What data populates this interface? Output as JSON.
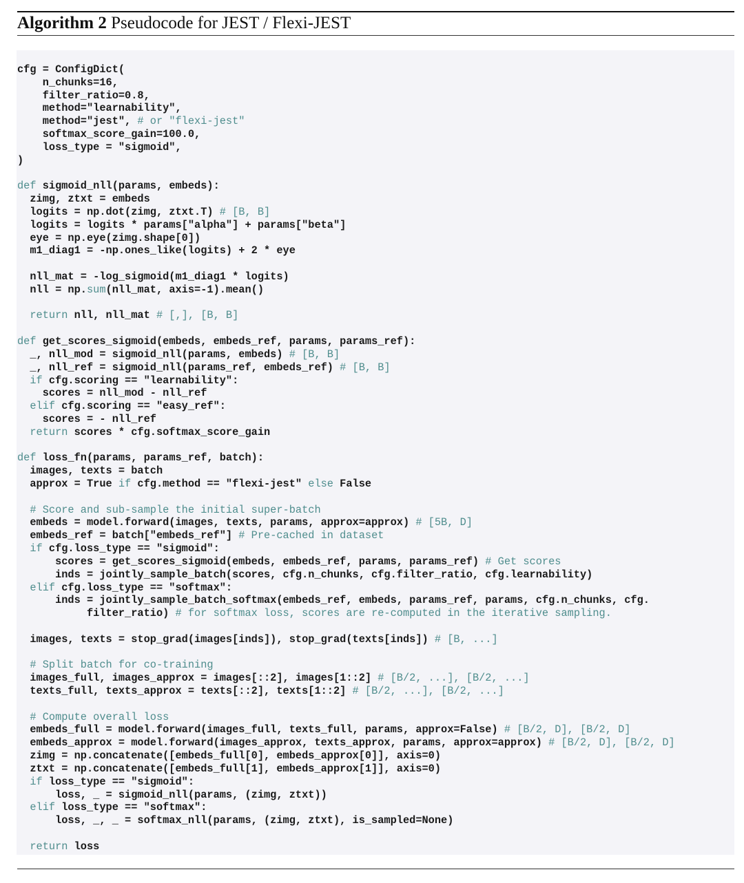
{
  "algorithm": {
    "label": "Algorithm 2",
    "caption": "Pseudocode for JEST / Flexi-JEST"
  },
  "colors": {
    "keyword": "#4f8d8d",
    "comment": "#4f8d8d",
    "background": "#f4f4f8"
  },
  "code": {
    "lines": [
      [
        [
          "t",
          "cfg = ConfigDict("
        ]
      ],
      [
        [
          "t",
          "    n_chunks=16,"
        ]
      ],
      [
        [
          "t",
          "    filter_ratio=0.8,"
        ]
      ],
      [
        [
          "t",
          "    method=\"learnability\","
        ]
      ],
      [
        [
          "t",
          "    method=\"jest\", "
        ],
        [
          "c",
          "# or \"flexi-jest\""
        ]
      ],
      [
        [
          "t",
          "    softmax_score_gain=100.0,"
        ]
      ],
      [
        [
          "t",
          "    loss_type = \"sigmoid\","
        ]
      ],
      [
        [
          "t",
          ")"
        ]
      ],
      [],
      [
        [
          "k",
          "def"
        ],
        [
          "t",
          " sigmoid_nll(params, embeds):"
        ]
      ],
      [
        [
          "t",
          "  zimg, ztxt = embeds"
        ]
      ],
      [
        [
          "t",
          "  logits = np.dot(zimg, ztxt.T) "
        ],
        [
          "c",
          "# [B, B]"
        ]
      ],
      [
        [
          "t",
          "  logits = logits * params[\"alpha\"] + params[\"beta\"]"
        ]
      ],
      [
        [
          "t",
          "  eye = np.eye(zimg.shape[0])"
        ]
      ],
      [
        [
          "t",
          "  m1_diag1 = -np.ones_like(logits) + 2 * eye"
        ]
      ],
      [],
      [
        [
          "t",
          "  nll_mat = -log_sigmoid(m1_diag1 * logits)"
        ]
      ],
      [
        [
          "t",
          "  nll = np."
        ],
        [
          "k",
          "sum"
        ],
        [
          "t",
          "(nll_mat, axis=-1).mean()"
        ]
      ],
      [],
      [
        [
          "k",
          "  return"
        ],
        [
          "t",
          " nll, nll_mat "
        ],
        [
          "c",
          "# [,], [B, B]"
        ]
      ],
      [],
      [
        [
          "k",
          "def"
        ],
        [
          "t",
          " get_scores_sigmoid(embeds, embeds_ref, params, params_ref):"
        ]
      ],
      [
        [
          "t",
          "  _, nll_mod = sigmoid_nll(params, embeds) "
        ],
        [
          "c",
          "# [B, B]"
        ]
      ],
      [
        [
          "t",
          "  _, nll_ref = sigmoid_nll(params_ref, embeds_ref) "
        ],
        [
          "c",
          "# [B, B]"
        ]
      ],
      [
        [
          "k",
          "  if"
        ],
        [
          "t",
          " cfg.scoring == \"learnability\":"
        ]
      ],
      [
        [
          "t",
          "    scores = nll_mod - nll_ref"
        ]
      ],
      [
        [
          "k",
          "  elif"
        ],
        [
          "t",
          " cfg.scoring == \"easy_ref\":"
        ]
      ],
      [
        [
          "t",
          "    scores = - nll_ref"
        ]
      ],
      [
        [
          "k",
          "  return"
        ],
        [
          "t",
          " scores * cfg.softmax_score_gain"
        ]
      ],
      [],
      [
        [
          "k",
          "def"
        ],
        [
          "t",
          " loss_fn(params, params_ref, batch):"
        ]
      ],
      [
        [
          "t",
          "  images, texts = batch"
        ]
      ],
      [
        [
          "t",
          "  approx = True "
        ],
        [
          "k",
          "if"
        ],
        [
          "t",
          " cfg.method == \"flexi-jest\" "
        ],
        [
          "k",
          "else"
        ],
        [
          "t",
          " False"
        ]
      ],
      [],
      [
        [
          "c",
          "  # Score and sub-sample the initial super-batch"
        ]
      ],
      [
        [
          "t",
          "  embeds = model.forward(images, texts, params, approx=approx) "
        ],
        [
          "c",
          "# [5B, D]"
        ]
      ],
      [
        [
          "t",
          "  embeds_ref = batch[\"embeds_ref\"] "
        ],
        [
          "c",
          "# Pre-cached in dataset"
        ]
      ],
      [
        [
          "k",
          "  if"
        ],
        [
          "t",
          " cfg.loss_type == \"sigmoid\":"
        ]
      ],
      [
        [
          "t",
          "      scores = get_scores_sigmoid(embeds, embeds_ref, params, params_ref) "
        ],
        [
          "c",
          "# Get scores"
        ]
      ],
      [
        [
          "t",
          "      inds = jointly_sample_batch(scores, cfg.n_chunks, cfg.filter_ratio, cfg.learnability)"
        ]
      ],
      [
        [
          "k",
          "  elif"
        ],
        [
          "t",
          " cfg.loss_type == \"softmax\":"
        ]
      ],
      [
        [
          "t",
          "      inds = jointly_sample_batch_softmax(embeds_ref, embeds, params_ref, params, cfg.n_chunks, cfg."
        ]
      ],
      [
        [
          "t",
          "           filter_ratio) "
        ],
        [
          "c",
          "# for softmax loss, scores are re-computed in the iterative sampling."
        ]
      ],
      [],
      [
        [
          "t",
          "  images, texts = stop_grad(images[inds]), stop_grad(texts[inds]) "
        ],
        [
          "c",
          "# [B, ...]"
        ]
      ],
      [],
      [
        [
          "c",
          "  # Split batch for co-training"
        ]
      ],
      [
        [
          "t",
          "  images_full, images_approx = images[::2], images[1::2] "
        ],
        [
          "c",
          "# [B/2, ...], [B/2, ...]"
        ]
      ],
      [
        [
          "t",
          "  texts_full, texts_approx = texts[::2], texts[1::2] "
        ],
        [
          "c",
          "# [B/2, ...], [B/2, ...]"
        ]
      ],
      [],
      [
        [
          "c",
          "  # Compute overall loss"
        ]
      ],
      [
        [
          "t",
          "  embeds_full = model.forward(images_full, texts_full, params, approx=False) "
        ],
        [
          "c",
          "# [B/2, D], [B/2, D]"
        ]
      ],
      [
        [
          "t",
          "  embeds_approx = model.forward(images_approx, texts_approx, params, approx=approx) "
        ],
        [
          "c",
          "# [B/2, D], [B/2, D]"
        ]
      ],
      [
        [
          "t",
          "  zimg = np.concatenate([embeds_full[0], embeds_approx[0]], axis=0)"
        ]
      ],
      [
        [
          "t",
          "  ztxt = np.concatenate([embeds_full[1], embeds_approx[1]], axis=0)"
        ]
      ],
      [
        [
          "k",
          "  if"
        ],
        [
          "t",
          " loss_type == \"sigmoid\":"
        ]
      ],
      [
        [
          "t",
          "      loss, _ = sigmoid_nll(params, (zimg, ztxt))"
        ]
      ],
      [
        [
          "k",
          "  elif"
        ],
        [
          "t",
          " loss_type == \"softmax\":"
        ]
      ],
      [
        [
          "t",
          "      loss, _, _ = softmax_nll(params, (zimg, ztxt), is_sampled=None)"
        ]
      ],
      [],
      [
        [
          "k",
          "  return"
        ],
        [
          "t",
          " loss"
        ]
      ]
    ]
  }
}
